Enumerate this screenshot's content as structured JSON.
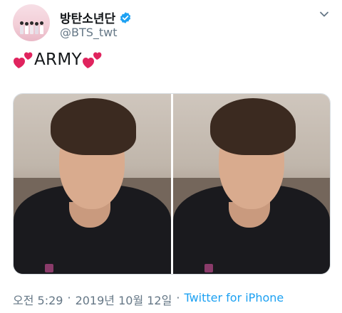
{
  "account": {
    "display_name": "방탄소년단",
    "handle": "@BTS_twt",
    "verified_icon": "verified-badge-icon",
    "options_icon": "chevron-down-icon"
  },
  "tweet": {
    "text": "ARMY",
    "emoji": "two-hearts"
  },
  "media": {
    "photo_count": 2
  },
  "meta": {
    "time": "오전 5:29",
    "separator_1": "·",
    "date": "2019년 10월 12일",
    "separator_2": "·",
    "source": "Twitter for iPhone"
  },
  "colors": {
    "verified_blue": "#1da1f2",
    "link_blue": "#1da1f2",
    "meta_gray": "#657786",
    "heart_pink": "#e0245e"
  }
}
